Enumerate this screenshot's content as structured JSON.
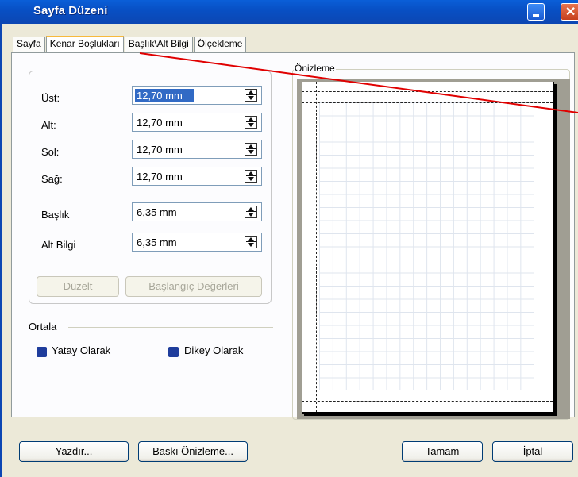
{
  "window": {
    "title": "Sayfa Düzeni"
  },
  "tabs": [
    {
      "label": "Sayfa",
      "active": false
    },
    {
      "label": "Kenar Boşlukları",
      "active": true
    },
    {
      "label": "Başlık\\Alt Bilgi",
      "active": false
    },
    {
      "label": "Ölçekleme",
      "active": false
    }
  ],
  "margins": {
    "top": {
      "label": "Üst:",
      "value": "12,70 mm"
    },
    "bottom": {
      "label": "Alt:",
      "value": "12,70 mm"
    },
    "left": {
      "label": "Sol:",
      "value": "12,70 mm"
    },
    "right": {
      "label": "Sağ:",
      "value": "12,70 mm"
    },
    "header": {
      "label": "Başlık",
      "value": "6,35 mm"
    },
    "footer": {
      "label": "Alt Bilgi",
      "value": "6,35 mm"
    }
  },
  "group_buttons": {
    "edit": "Düzelt",
    "defaults": "Başlangıç Değerleri"
  },
  "center": {
    "title": "Ortala",
    "horizontal": "Yatay Olarak",
    "vertical": "Dikey Olarak"
  },
  "preview": {
    "title": "Önizleme"
  },
  "footer_buttons": {
    "print": "Yazdır...",
    "print_preview": "Baskı Önizleme...",
    "ok": "Tamam",
    "cancel": "İptal"
  },
  "colors": {
    "title_bar": "#0a5fd8",
    "dialog_bg": "#ece9d8",
    "annotation_line": "#e00000"
  }
}
